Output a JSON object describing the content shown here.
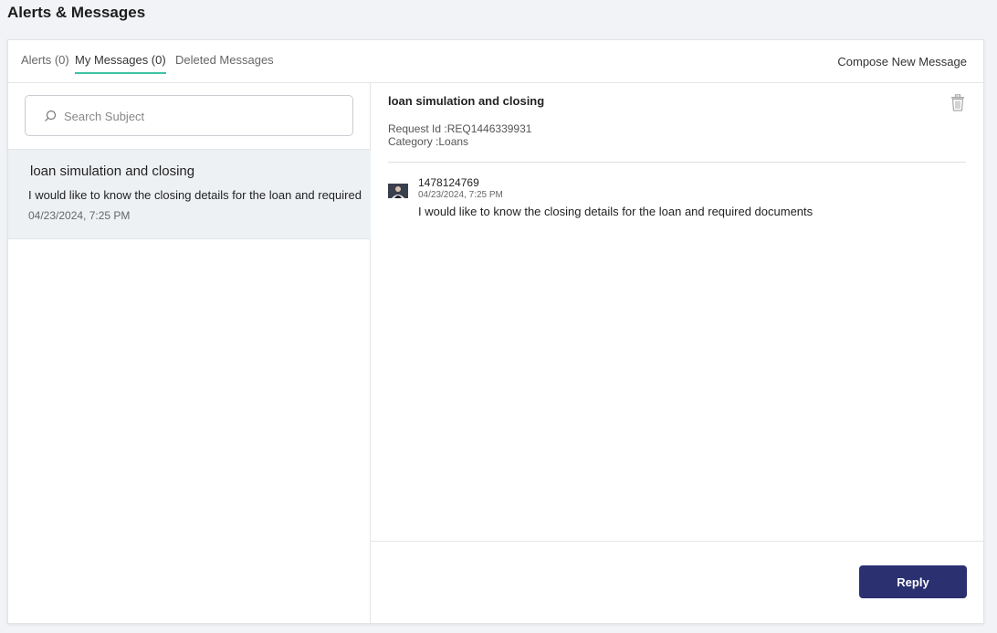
{
  "page": {
    "title": "Alerts & Messages"
  },
  "tabs": [
    {
      "label": "Alerts (0)"
    },
    {
      "label": "My Messages (0)"
    },
    {
      "label": "Deleted Messages"
    }
  ],
  "compose_label": "Compose New Message",
  "search": {
    "placeholder": "Search Subject",
    "value": ""
  },
  "messages": [
    {
      "subject": "loan simulation and closing",
      "preview": "I would like to know the closing details for the loan and required",
      "date": "04/23/2024, 7:25 PM"
    }
  ],
  "detail": {
    "subject": "loan simulation and closing",
    "request_id": "Request Id :REQ1446339931",
    "category": "Category :Loans",
    "sender": "1478124769",
    "sent_date": "04/23/2024, 7:25 PM",
    "body": "I would like to know the closing details for the loan and required documents"
  },
  "reply_label": "Reply",
  "colors": {
    "accent": "#3ec3a5",
    "primary_button": "#2b3070"
  },
  "icons": {
    "search": "search-icon",
    "trash": "trash-icon",
    "avatar": "avatar"
  }
}
